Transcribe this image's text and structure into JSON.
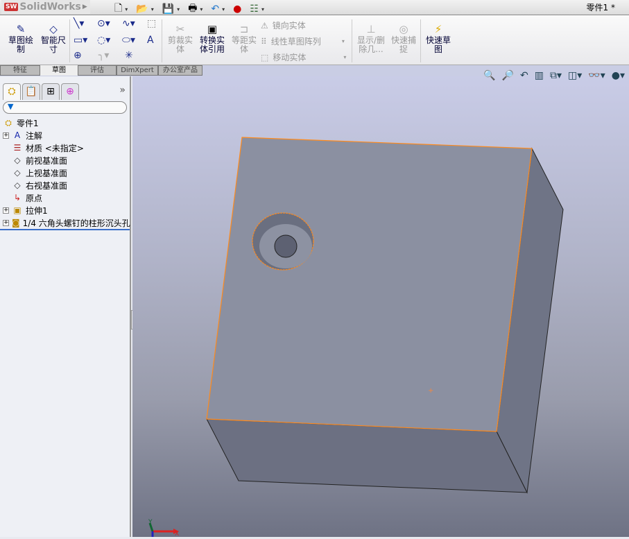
{
  "app": {
    "name": "SolidWorks",
    "document_title": "零件1 *"
  },
  "quick_access": [
    {
      "icon": "new-document-icon"
    },
    {
      "icon": "open-folder-icon"
    },
    {
      "icon": "save-icon"
    },
    {
      "icon": "print-icon"
    },
    {
      "icon": "undo-icon"
    },
    {
      "icon": "rebuild-traffic-light-icon"
    },
    {
      "icon": "options-icon"
    }
  ],
  "ribbon": {
    "sketch": "草图绘\n制",
    "smart_dim": "智能尺\n寸",
    "trim": "剪裁实\n体",
    "convert": "转换实\n体引用",
    "offset": "等距实\n体",
    "mirror": "镜向实体",
    "linear_pattern": "线性草图阵列",
    "move": "移动实体",
    "show_delete": "显示/删\n除几...",
    "quick_snap": "快速捕\n捉",
    "rapid_sketch": "快速草\n图"
  },
  "tabs": [
    {
      "label": "特征"
    },
    {
      "label": "草图",
      "active": true
    },
    {
      "label": "评估"
    },
    {
      "label": "DimXpert"
    },
    {
      "label": "办公室产品"
    }
  ],
  "tree": {
    "root": "零件1",
    "items": [
      {
        "label": "注解",
        "expandable": true,
        "icon": "annotations-icon"
      },
      {
        "label": "材质 <未指定>",
        "expandable": false,
        "icon": "material-icon"
      },
      {
        "label": "前视基准面",
        "expandable": false,
        "icon": "plane-icon"
      },
      {
        "label": "上视基准面",
        "expandable": false,
        "icon": "plane-icon"
      },
      {
        "label": "右视基准面",
        "expandable": false,
        "icon": "plane-icon"
      },
      {
        "label": "原点",
        "expandable": false,
        "icon": "origin-icon"
      },
      {
        "label": "拉伸1",
        "expandable": true,
        "icon": "extrude-icon"
      },
      {
        "label": "1/4 六角头螺钉的柱形沉头孔",
        "expandable": true,
        "icon": "hole-wizard-icon"
      }
    ]
  },
  "triad": {
    "x": "X",
    "y": "Y"
  },
  "colors": {
    "top_face": "#8b90a1",
    "right_face": "#6f7486",
    "front_face": "#6c7082",
    "edge_highlight": "#ff8a1c"
  }
}
